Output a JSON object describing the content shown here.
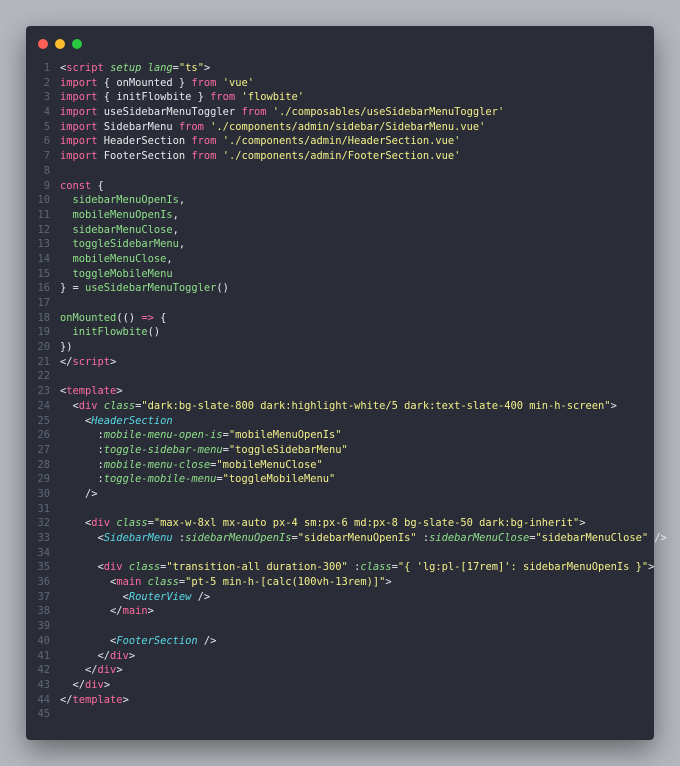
{
  "window": {
    "traffic_lights": [
      {
        "name": "close",
        "color": "#ff5f56"
      },
      {
        "name": "minimize",
        "color": "#ffbd2e"
      },
      {
        "name": "maximize",
        "color": "#27c93f"
      }
    ]
  },
  "colors": {
    "background": "#2a2d37",
    "line_number": "#5f6775",
    "text": "#e8eaed",
    "tag": "#ff6b9f",
    "component": "#58d8e6",
    "attribute": "#8fe08a",
    "string": "#f3f08a"
  },
  "code_lines": [
    [
      [
        "p",
        "<"
      ],
      [
        "t",
        "script"
      ],
      [
        "p",
        " "
      ],
      [
        "a",
        "setup"
      ],
      [
        "p",
        " "
      ],
      [
        "a",
        "lang"
      ],
      [
        "p",
        "="
      ],
      [
        "s",
        "\"ts\""
      ],
      [
        "p",
        ">"
      ]
    ],
    [
      [
        "k",
        "import"
      ],
      [
        "p",
        " { onMounted } "
      ],
      [
        "k",
        "from"
      ],
      [
        "p",
        " "
      ],
      [
        "s",
        "'vue'"
      ]
    ],
    [
      [
        "k",
        "import"
      ],
      [
        "p",
        " { initFlowbite } "
      ],
      [
        "k",
        "from"
      ],
      [
        "p",
        " "
      ],
      [
        "s",
        "'flowbite'"
      ]
    ],
    [
      [
        "k",
        "import"
      ],
      [
        "p",
        " useSidebarMenuToggler "
      ],
      [
        "k",
        "from"
      ],
      [
        "p",
        " "
      ],
      [
        "s",
        "'./composables/useSidebarMenuToggler'"
      ]
    ],
    [
      [
        "k",
        "import"
      ],
      [
        "p",
        " SidebarMenu "
      ],
      [
        "k",
        "from"
      ],
      [
        "p",
        " "
      ],
      [
        "s",
        "'./components/admin/sidebar/SidebarMenu.vue'"
      ]
    ],
    [
      [
        "k",
        "import"
      ],
      [
        "p",
        " HeaderSection "
      ],
      [
        "k",
        "from"
      ],
      [
        "p",
        " "
      ],
      [
        "s",
        "'./components/admin/HeaderSection.vue'"
      ]
    ],
    [
      [
        "k",
        "import"
      ],
      [
        "p",
        " FooterSection "
      ],
      [
        "k",
        "from"
      ],
      [
        "p",
        " "
      ],
      [
        "s",
        "'./components/admin/FooterSection.vue'"
      ]
    ],
    [],
    [
      [
        "k",
        "const"
      ],
      [
        "p",
        " {"
      ]
    ],
    [
      [
        "p",
        "  "
      ],
      [
        "v",
        "sidebarMenuOpenIs"
      ],
      [
        "p",
        ","
      ]
    ],
    [
      [
        "p",
        "  "
      ],
      [
        "v",
        "mobileMenuOpenIs"
      ],
      [
        "p",
        ","
      ]
    ],
    [
      [
        "p",
        "  "
      ],
      [
        "v",
        "sidebarMenuClose"
      ],
      [
        "p",
        ","
      ]
    ],
    [
      [
        "p",
        "  "
      ],
      [
        "v",
        "toggleSidebarMenu"
      ],
      [
        "p",
        ","
      ]
    ],
    [
      [
        "p",
        "  "
      ],
      [
        "v",
        "mobileMenuClose"
      ],
      [
        "p",
        ","
      ]
    ],
    [
      [
        "p",
        "  "
      ],
      [
        "v",
        "toggleMobileMenu"
      ]
    ],
    [
      [
        "p",
        "} = "
      ],
      [
        "v",
        "useSidebarMenuToggler"
      ],
      [
        "p",
        "()"
      ]
    ],
    [],
    [
      [
        "v",
        "onMounted"
      ],
      [
        "p",
        "(() "
      ],
      [
        "k",
        "=>"
      ],
      [
        "p",
        " {"
      ]
    ],
    [
      [
        "p",
        "  "
      ],
      [
        "v",
        "initFlowbite"
      ],
      [
        "p",
        "()"
      ]
    ],
    [
      [
        "p",
        "})"
      ]
    ],
    [
      [
        "p",
        "</"
      ],
      [
        "t",
        "script"
      ],
      [
        "p",
        ">"
      ]
    ],
    [],
    [
      [
        "p",
        "<"
      ],
      [
        "t",
        "template"
      ],
      [
        "p",
        ">"
      ]
    ],
    [
      [
        "p",
        "  <"
      ],
      [
        "t",
        "div"
      ],
      [
        "p",
        " "
      ],
      [
        "a",
        "class"
      ],
      [
        "p",
        "="
      ],
      [
        "s",
        "\"dark:bg-slate-800 dark:highlight-white/5 dark:text-slate-400 min-h-screen\""
      ],
      [
        "p",
        ">"
      ]
    ],
    [
      [
        "p",
        "    <"
      ],
      [
        "c",
        "HeaderSection"
      ]
    ],
    [
      [
        "p",
        "      :"
      ],
      [
        "a",
        "mobile-menu-open-is"
      ],
      [
        "p",
        "="
      ],
      [
        "s",
        "\"mobileMenuOpenIs\""
      ]
    ],
    [
      [
        "p",
        "      :"
      ],
      [
        "a",
        "toggle-sidebar-menu"
      ],
      [
        "p",
        "="
      ],
      [
        "s",
        "\"toggleSidebarMenu\""
      ]
    ],
    [
      [
        "p",
        "      :"
      ],
      [
        "a",
        "mobile-menu-close"
      ],
      [
        "p",
        "="
      ],
      [
        "s",
        "\"mobileMenuClose\""
      ]
    ],
    [
      [
        "p",
        "      :"
      ],
      [
        "a",
        "toggle-mobile-menu"
      ],
      [
        "p",
        "="
      ],
      [
        "s",
        "\"toggleMobileMenu\""
      ]
    ],
    [
      [
        "p",
        "    />"
      ]
    ],
    [],
    [
      [
        "p",
        "    <"
      ],
      [
        "t",
        "div"
      ],
      [
        "p",
        " "
      ],
      [
        "a",
        "class"
      ],
      [
        "p",
        "="
      ],
      [
        "s",
        "\"max-w-8xl mx-auto px-4 sm:px-6 md:px-8 bg-slate-50 dark:bg-inherit\""
      ],
      [
        "p",
        ">"
      ]
    ],
    [
      [
        "p",
        "      <"
      ],
      [
        "c",
        "SidebarMenu"
      ],
      [
        "p",
        " :"
      ],
      [
        "a",
        "sidebarMenuOpenIs"
      ],
      [
        "p",
        "="
      ],
      [
        "s",
        "\"sidebarMenuOpenIs\""
      ],
      [
        "p",
        " :"
      ],
      [
        "a",
        "sidebarMenuClose"
      ],
      [
        "p",
        "="
      ],
      [
        "s",
        "\"sidebarMenuClose\""
      ],
      [
        "p",
        " />"
      ]
    ],
    [],
    [
      [
        "p",
        "      <"
      ],
      [
        "t",
        "div"
      ],
      [
        "p",
        " "
      ],
      [
        "a",
        "class"
      ],
      [
        "p",
        "="
      ],
      [
        "s",
        "\"transition-all duration-300\""
      ],
      [
        "p",
        " :"
      ],
      [
        "a",
        "class"
      ],
      [
        "p",
        "="
      ],
      [
        "s",
        "\"{ 'lg:pl-[17rem]': sidebarMenuOpenIs }\""
      ],
      [
        "p",
        ">"
      ]
    ],
    [
      [
        "p",
        "        <"
      ],
      [
        "t",
        "main"
      ],
      [
        "p",
        " "
      ],
      [
        "a",
        "class"
      ],
      [
        "p",
        "="
      ],
      [
        "s",
        "\"pt-5 min-h-[calc(100vh-13rem)]\""
      ],
      [
        "p",
        ">"
      ]
    ],
    [
      [
        "p",
        "          <"
      ],
      [
        "c",
        "RouterView"
      ],
      [
        "p",
        " />"
      ]
    ],
    [
      [
        "p",
        "        </"
      ],
      [
        "t",
        "main"
      ],
      [
        "p",
        ">"
      ]
    ],
    [],
    [
      [
        "p",
        "        <"
      ],
      [
        "c",
        "FooterSection"
      ],
      [
        "p",
        " />"
      ]
    ],
    [
      [
        "p",
        "      </"
      ],
      [
        "t",
        "div"
      ],
      [
        "p",
        ">"
      ]
    ],
    [
      [
        "p",
        "    </"
      ],
      [
        "t",
        "div"
      ],
      [
        "p",
        ">"
      ]
    ],
    [
      [
        "p",
        "  </"
      ],
      [
        "t",
        "div"
      ],
      [
        "p",
        ">"
      ]
    ],
    [
      [
        "p",
        "</"
      ],
      [
        "t",
        "template"
      ],
      [
        "p",
        ">"
      ]
    ],
    []
  ]
}
